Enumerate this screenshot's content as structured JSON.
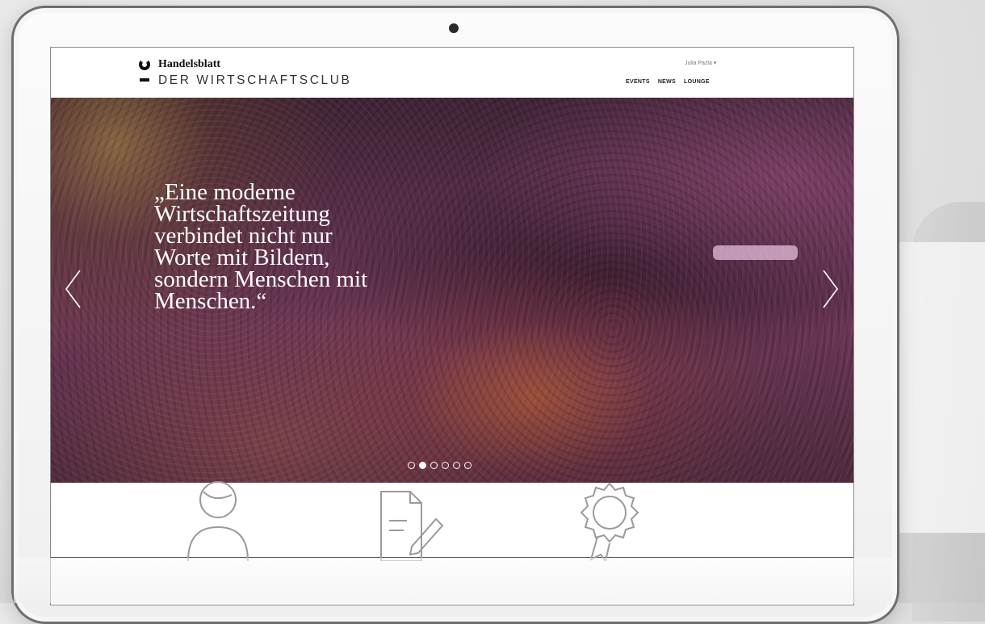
{
  "header": {
    "brand_top": "Handelsblatt",
    "brand_bottom": "DER WIRTSCHAFTSCLUB",
    "user_menu": "Julia Pazla ▾",
    "nav": [
      "EVENTS",
      "NEWS",
      "LOUNGE"
    ]
  },
  "hero": {
    "quote": "„Eine moderne\nWirtschaftszeitung\nverbindet nicht nur\nWorte mit Bildern,\nsondern Menschen mit\nMenschen.“",
    "slide_count": 6,
    "active_slide": 2
  },
  "icons": {
    "prev": "chevron-left-icon",
    "next": "chevron-right-icon",
    "features": [
      "user-icon",
      "document-edit-icon",
      "award-icon"
    ]
  },
  "colors": {
    "hero_base": "#5a2f4a",
    "text_on_hero": "#ffffff",
    "nav_text": "#222222"
  }
}
